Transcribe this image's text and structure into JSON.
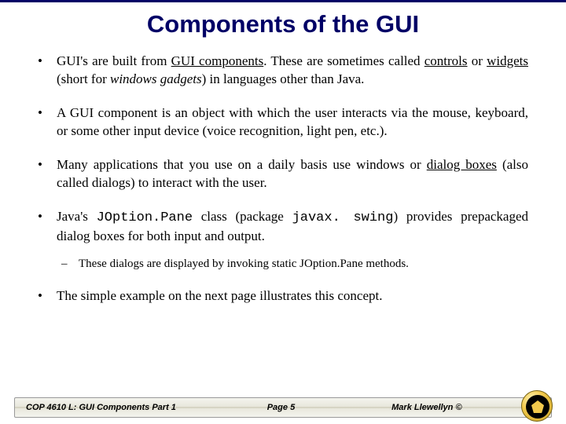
{
  "title": "Components of the GUI",
  "bullets": {
    "b1_pre": "GUI's are built from ",
    "b1_u1": "GUI components",
    "b1_mid1": ". These are sometimes called ",
    "b1_u2": "controls",
    "b1_mid2": " or ",
    "b1_u3": "widgets",
    "b1_mid3": " (short for ",
    "b1_i1": "windows gadgets",
    "b1_post": ") in languages other than Java.",
    "b2": "A GUI component is an object with which the user interacts via the mouse, keyboard, or some other input device (voice recognition, light pen, etc.).",
    "b3_pre": "Many applications that you use on a daily basis use windows or ",
    "b3_u1": "dialog boxes",
    "b3_post": " (also called dialogs) to interact with the user.",
    "b4_pre": "Java's ",
    "b4_c1": "JOption.Pane",
    "b4_mid1": " class (package ",
    "b4_c2": "javax. swing",
    "b4_post": ") provides prepackaged dialog boxes for both input and output.",
    "b4_sub": "These dialogs are displayed by invoking static JOption.Pane methods.",
    "b5": "The simple example on the next page illustrates this concept."
  },
  "footer": {
    "course": "COP 4610 L: GUI Components Part 1",
    "page": "Page 5",
    "author": "Mark Llewellyn ©"
  }
}
